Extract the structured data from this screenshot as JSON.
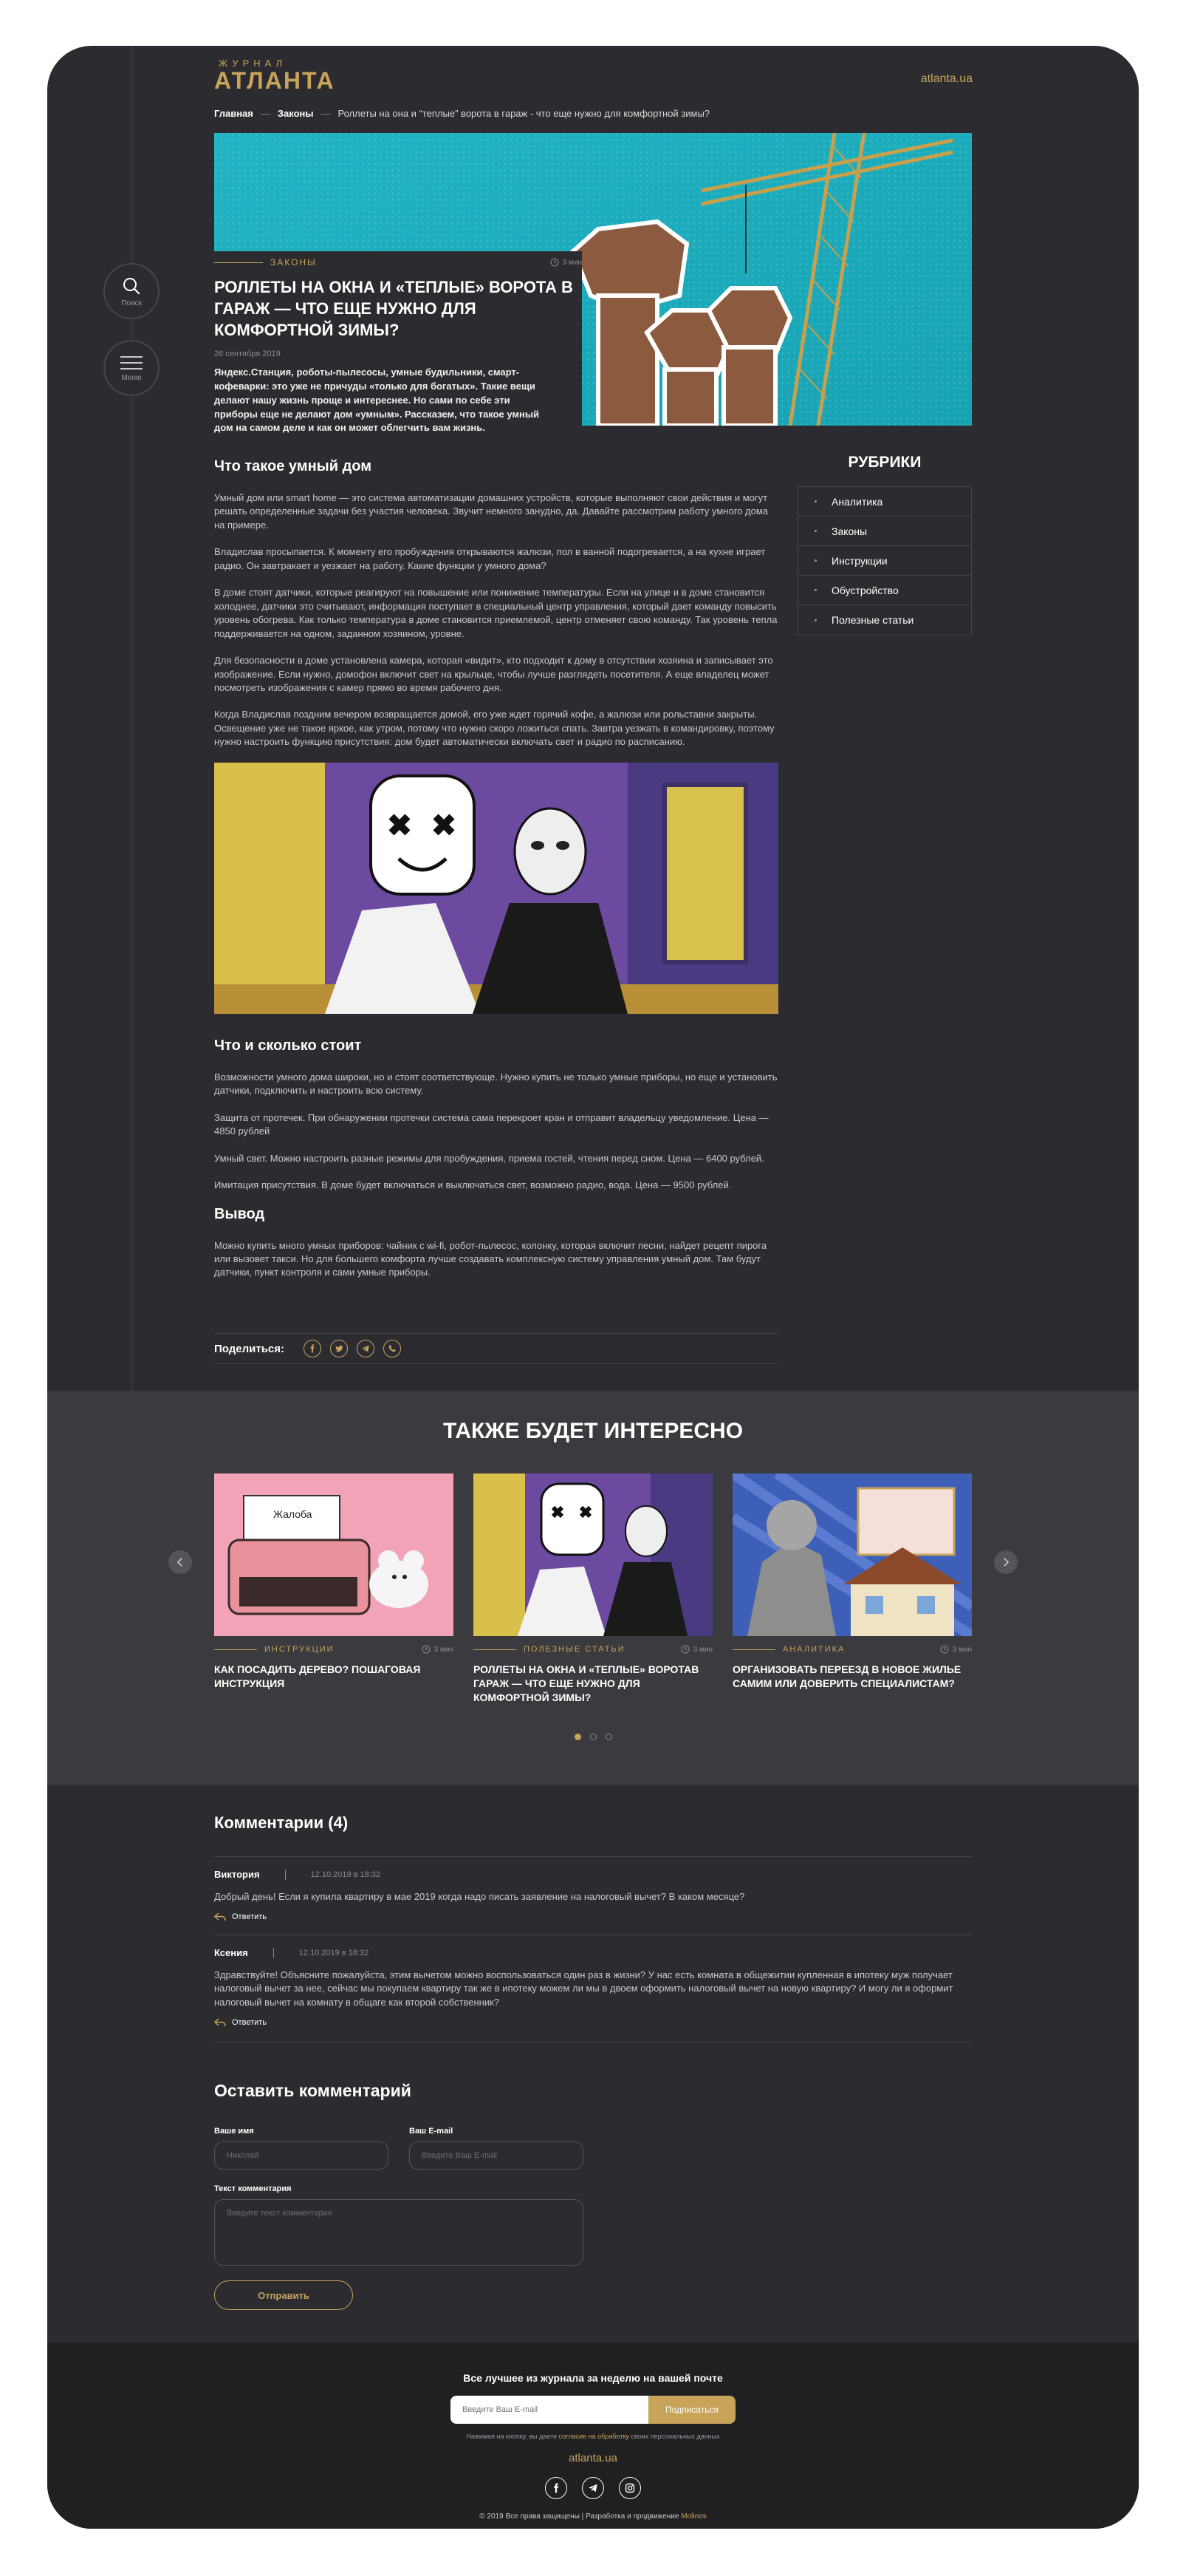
{
  "logo": {
    "small": "ЖУРНАЛ",
    "big": "АТЛАНТА"
  },
  "site_url": "atlanta.ua",
  "side": {
    "search_label": "Поиск",
    "menu_label": "Меню"
  },
  "breadcrumbs": {
    "home": "Главная",
    "section": "Законы",
    "current": "Роллеты на она и “теплые” ворота в гараж - что еще нужно для комфортной зимы?",
    "sep": "—"
  },
  "hero": {
    "category": "ЗАКОНЫ",
    "read_time": "3 мин",
    "title": "Роллеты на окна и «теплые» ворота в гараж — что еще нужно для комфортной зимы?",
    "date": "26 сентября 2019",
    "lead": "Яндекс.Станция, роботы-пылесосы, умные будильники, смарт-кофеварки: это уже не причуды «только для богатых». Такие вещи делают нашу жизнь проще и интереснее. Но сами по себе эти приборы еще не делают дом «умным». Рассказем, что такое умный дом на самом деле и как он может облегчить вам жизнь."
  },
  "article": {
    "h1": "Что такое умный дом",
    "p1": "Умный дом или smart home — это система автоматизации домашних устройств, которые выполняют свои действия и могут решать определенные задачи без участия человека. Звучит немного занудно, да. Давайте рассмотрим работу умного дома на примере.",
    "p2": "Владислав просыпается. К моменту его пробуждения открываются жалюзи, пол в ванной подогревается, а на кухне играет радио. Он завтракает и уезжает на работу. Какие функции у умного дома?",
    "p3": "В доме стоят датчики, которые реагируют на повышение или понижение температуры. Если на улице и в доме становится холоднее, датчики это считывают, информация поступает в специальный центр управления, который дает команду повысить уровень обогрева. Как только температура в доме становится приемлемой, центр отменяет свою команду. Так уровень тепла поддерживается на одном, заданном хозяином, уровне.",
    "p4": "Для безопасности в доме установлена камера, которая «видит», кто подходит к дому в отсутствии хозяина и записывает это изображение. Если нужно, домофон включит свет на крыльце, чтобы лучше разглядеть посетителя. А еще владелец может посмотреть изображения с камер прямо во время рабочего дня.",
    "p5": "Когда Владислав поздним вечером возвращается домой, его уже ждет горячий кофе, а жалюзи или рольставни закрыты. Освещение уже не такое яркое, как утром, потому что нужно скоро ложиться спать. Завтра уезжать в командировку, поэтому нужно настроить функцию присутствия: дом будет автоматически включать свет и радио по расписанию.",
    "h2": "Что и сколько стоит",
    "p6": "Возможности умного дома широки, но и стоят соответствующе. Нужно купить не только умные приборы, но еще и установить датчики, подключить и настроить всю систему.",
    "p7": "Защита от протечек. При обнаружении протечки система сама перекроет кран и отправит владельцу уведомление. Цена — 4850 рублей",
    "p8": "Умный свет. Можно настроить разные режимы для пробуждения, приема гостей, чтения перед сном. Цена — 6400 рублей.",
    "p9": "Имитация присутствия. В доме будет включаться и выключаться свет, возможно радио, вода. Цена — 9500 рублей.",
    "h3": "Вывод",
    "p10": "Можно купить много умных приборов: чайник с wi-fi, робот-пылесос, колонку, которая включит песни, найдет рецепт пирога или вызовет такси. Но для большего комфорта лучше создавать комплексную систему управления умный дом. Там будут датчики, пункт контроля и сами умные приборы."
  },
  "share_label": "Поделиться:",
  "rubrics": {
    "title": "РУБРИКИ",
    "items": [
      "Аналитика",
      "Законы",
      "Инструкции",
      "Обустройство",
      "Полезные статьи"
    ]
  },
  "related": {
    "title": "ТАКЖЕ БУДЕТ ИНТЕРЕСНО",
    "cards": [
      {
        "category": "ИНСТРУКЦИИ",
        "time": "3 мин",
        "title": "Как посадить дерево? Пошаговая инструкция",
        "paper": "Жалоба"
      },
      {
        "category": "ПОЛЕЗНЫЕ СТАТЬИ",
        "time": "3 мин",
        "title": "Роллеты на окна и «теплые» воротав гараж — что еще нужно для комфортной зимы?"
      },
      {
        "category": "АНАЛИТИКА",
        "time": "3 мин",
        "title": "Организовать переезд в новое жилье самим или доверить специалистам?"
      }
    ]
  },
  "comments": {
    "title": "Комментарии (4)",
    "reply_label": "Ответить",
    "items": [
      {
        "name": "Виктория",
        "date": "12.10.2019 в 18:32",
        "text": "Добрый день! Если я купила квартиру в мае 2019 когда надо писать заявление на налоговый вычет? В каком месяце?"
      },
      {
        "name": "Ксения",
        "date": "12.10.2019 в 18:32",
        "text": "Здравствуйте! Объясните пожалуйста, этим вычетом можно воспользоваться один раз в жизни? У нас есть комната в общежитии купленная в ипотеку муж получает налоговый вычет за нее, сейчас мы покупаем квартиру так же в ипотеку можем ли мы в двоем оформить налоговый вычет на новую квартиру? И могу ли я оформит налоговый вычет на комнату в общаге как второй собственник?"
      }
    ]
  },
  "form": {
    "title": "Оставить комментарий",
    "name_label": "Ваше имя",
    "name_placeholder": "Николай",
    "email_label": "Ваш E-mail",
    "email_placeholder": "Введите Ваш E-mail",
    "text_label": "Текст комментария",
    "text_placeholder": "Введите текст комментария",
    "submit_label": "Отправить"
  },
  "footer": {
    "subscribe_title": "Все лучшее из журнала за неделю на вашей почте",
    "email_placeholder": "Введите Ваш E-mail",
    "subscribe_button": "Подписаться",
    "consent_before": "Нажимая на кнопку, вы даете ",
    "consent_link": "согласие на обработку",
    "consent_after": " своих персональных данных",
    "site": "atlanta.ua",
    "copyright": "© 2019 Все права защищены | Разработка и продвижение ",
    "developer": "Molinos"
  }
}
